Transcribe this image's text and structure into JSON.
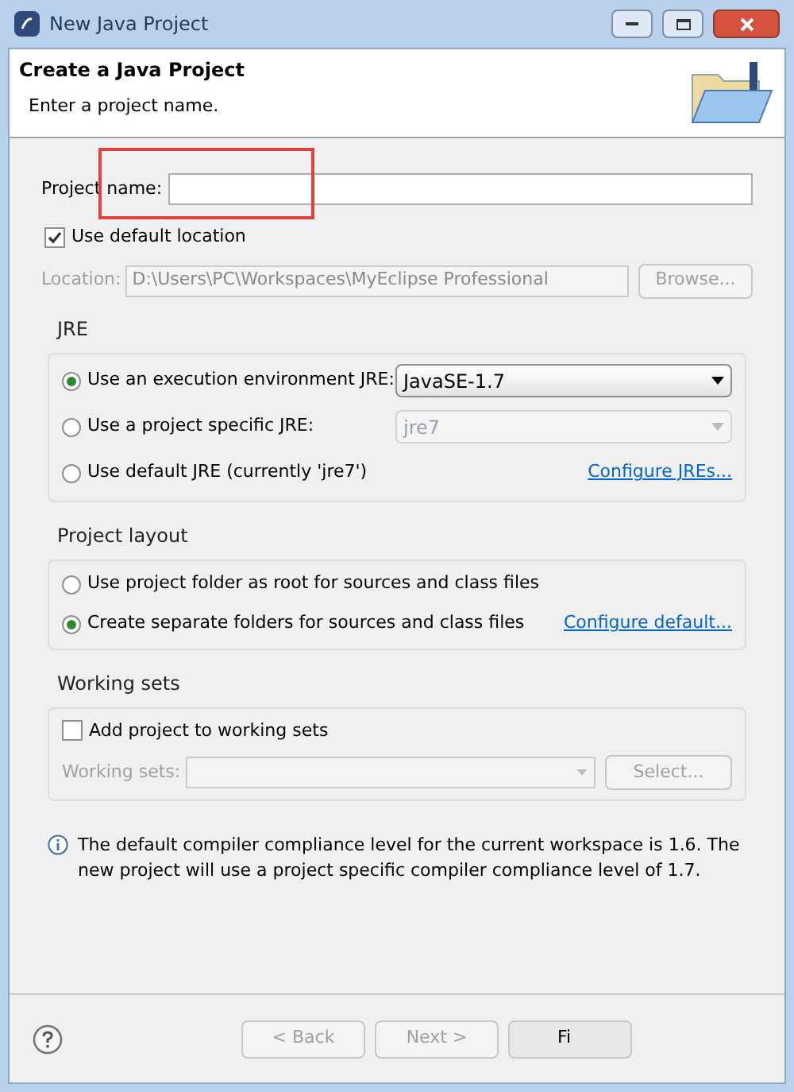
{
  "window": {
    "title": "New Java Project"
  },
  "header": {
    "title": "Create a Java Project",
    "subtitle": "Enter a project name."
  },
  "project_name": {
    "label": "Project name:"
  },
  "use_default_location": {
    "label": "Use default location",
    "checked": true
  },
  "location": {
    "label": "Location:",
    "value": "D:\\Users\\PC\\Workspaces\\MyEclipse Professional",
    "button": "Browse...",
    "disabled": true
  },
  "jre": {
    "title": "JRE",
    "options": [
      {
        "label": "Use an execution environment JRE:",
        "selected": true,
        "dropdown": {
          "value": "JavaSE-1.7",
          "disabled": false
        }
      },
      {
        "label": "Use a project specific JRE:",
        "selected": false,
        "dropdown": {
          "value": "jre7",
          "disabled": true
        }
      },
      {
        "label": "Use default JRE (currently 'jre7')",
        "selected": false,
        "link": "Configure JREs..."
      }
    ]
  },
  "project_layout": {
    "title": "Project layout",
    "options": [
      {
        "label": "Use project folder as root for sources and class files",
        "selected": false
      },
      {
        "label": "Create separate folders for sources and class files",
        "selected": true,
        "link": "Configure default..."
      }
    ]
  },
  "working_sets": {
    "title": "Working sets",
    "checkbox": {
      "label": "Add project to working sets",
      "checked": false
    },
    "field_label": "Working sets:",
    "button": "Select...",
    "disabled": true
  },
  "info": "The default compiler compliance level for the current workspace is 1.6. The new project will use a project specific compiler compliance level of 1.7.",
  "buttons": [
    {
      "label": "< Back",
      "disabled": true
    },
    {
      "label": "Next >",
      "disabled": true
    },
    {
      "label": "Fi",
      "disabled": false
    }
  ]
}
